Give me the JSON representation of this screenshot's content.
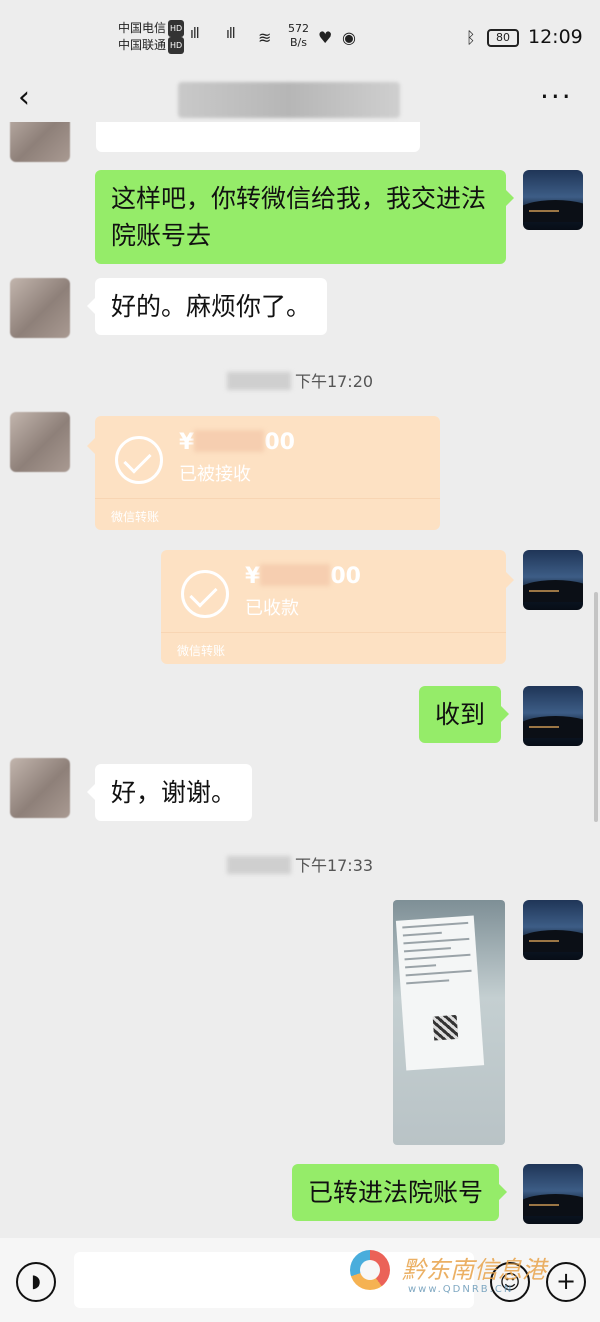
{
  "status_bar": {
    "carrier1": "中国电信",
    "carrier2": "中国联通",
    "hd_badge": "HD",
    "net_type": "4G",
    "speed_value": "572",
    "speed_unit": "B/s",
    "battery": "80",
    "time": "12:09"
  },
  "header": {
    "back_icon": "‹",
    "more_icon": "···"
  },
  "messages": {
    "m1_text": "这样吧，你转微信给我，我交进法院账号去",
    "m2_text": "好的。麻烦你了。",
    "ts1": "下午17:20",
    "t1_amount_suffix": "00",
    "t1_status": "已被接收",
    "t1_footer": "微信转账",
    "t2_amount_suffix": "00",
    "t2_status": "已收款",
    "t2_footer": "微信转账",
    "m3_text": "收到",
    "m4_text": "好，谢谢。",
    "ts2": "下午17:33",
    "m5_text": "已转进法院账号"
  },
  "input_bar": {
    "voice_icon": "◗",
    "emoji_icon": "☺",
    "plus_icon": "+"
  },
  "watermark": {
    "text": "黔东南信息港",
    "url": "www.QDNRB.CN"
  }
}
